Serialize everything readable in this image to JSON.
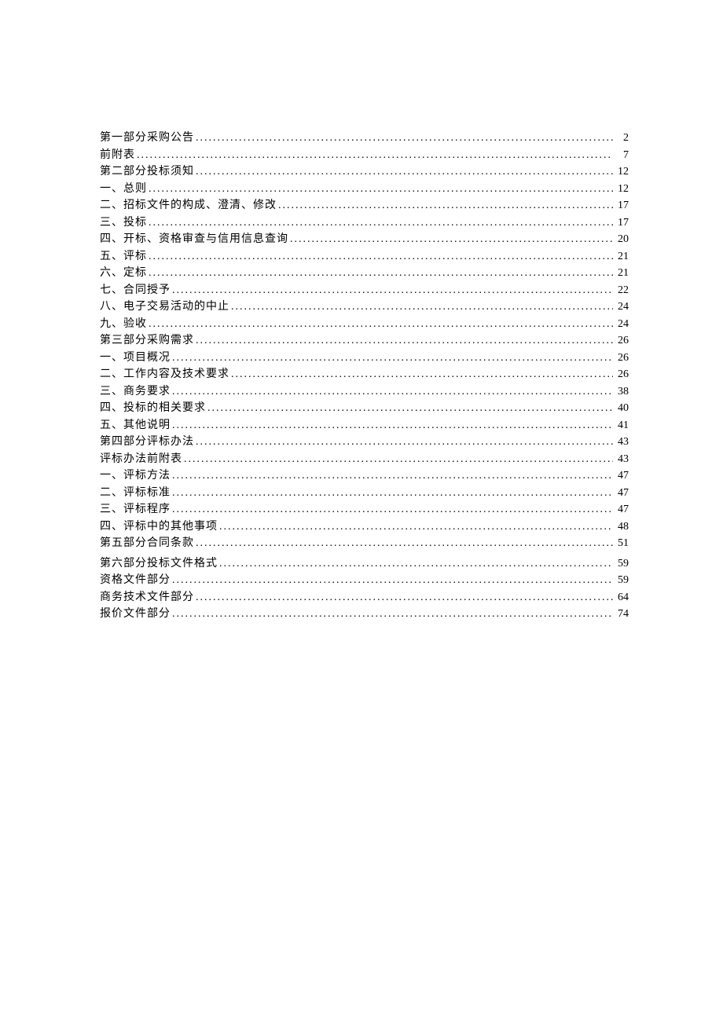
{
  "toc": {
    "group1": [
      {
        "title": "第一部分采购公告",
        "page": "2"
      },
      {
        "title": "前附表",
        "page": "7"
      },
      {
        "title": "第二部分投标须知",
        "page": "12"
      },
      {
        "title": "一、总则",
        "page": "12"
      },
      {
        "title": "二、招标文件的构成、澄清、修改",
        "page": "17"
      },
      {
        "title": "三、投标",
        "page": "17"
      },
      {
        "title": "四、开标、资格审查与信用信息查询",
        "page": "20"
      },
      {
        "title": "五、评标",
        "page": "21"
      },
      {
        "title": "六、定标",
        "page": "21"
      },
      {
        "title": "七、合同授予",
        "page": "22"
      },
      {
        "title": "八、电子交易活动的中止",
        "page": "24"
      },
      {
        "title": "九、验收",
        "page": "24"
      },
      {
        "title": "第三部分采购需求",
        "page": "26"
      },
      {
        "title": "一、项目概况",
        "page": "26"
      },
      {
        "title": "二、工作内容及技术要求",
        "page": "26"
      },
      {
        "title": "三、商务要求",
        "page": "38"
      },
      {
        "title": "四、投标的相关要求",
        "page": "40"
      },
      {
        "title": "五、其他说明",
        "page": "41"
      },
      {
        "title": "第四部分评标办法",
        "page": "43"
      },
      {
        "title": "评标办法前附表",
        "page": "43"
      },
      {
        "title": "一、评标方法",
        "page": "47"
      },
      {
        "title": "二、评标标准",
        "page": "47"
      },
      {
        "title": "三、评标程序",
        "page": "47"
      },
      {
        "title": "四、评标中的其他事项",
        "page": "48"
      },
      {
        "title": "第五部分合同条款",
        "page": "51"
      }
    ],
    "group2": [
      {
        "title": "第六部分投标文件格式",
        "page": "59"
      },
      {
        "title": "资格文件部分",
        "page": "59"
      },
      {
        "title": "商务技术文件部分",
        "page": "64"
      },
      {
        "title": "报价文件部分",
        "page": "74"
      }
    ]
  }
}
